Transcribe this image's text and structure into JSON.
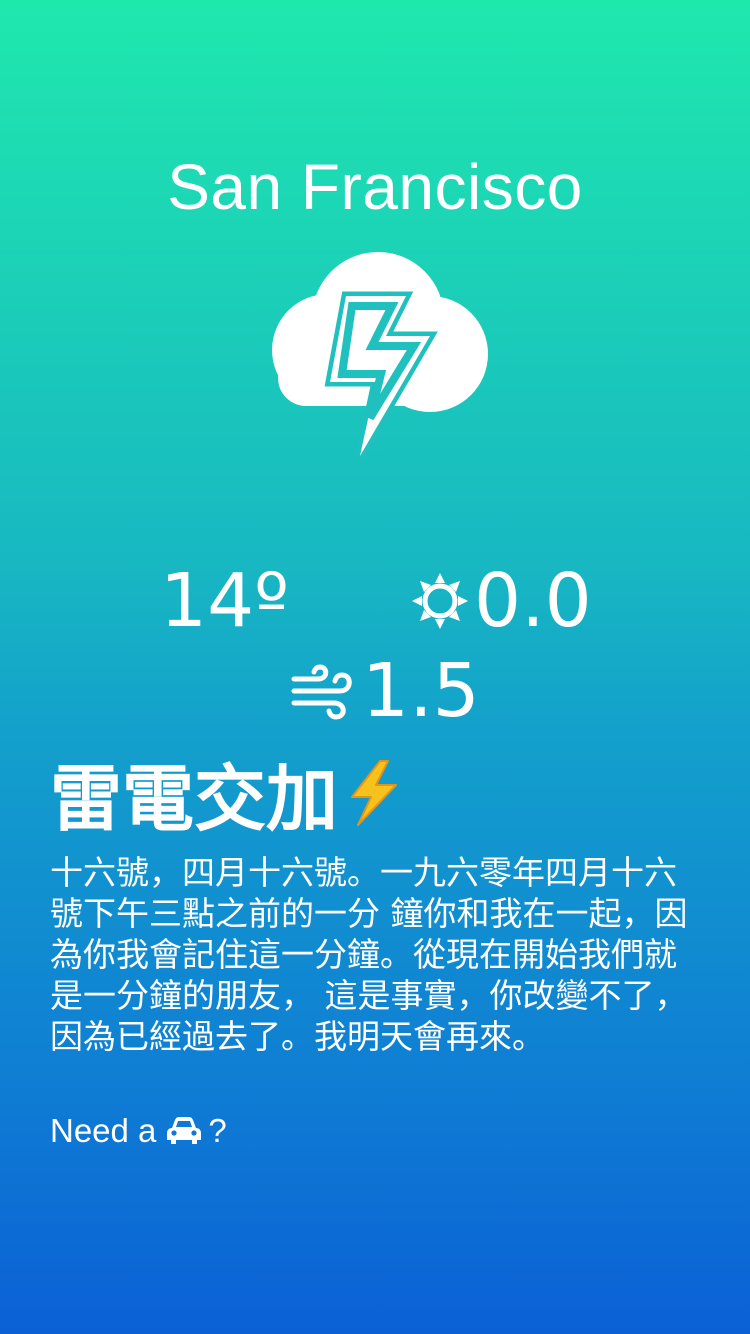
{
  "location": {
    "city": "San Francisco"
  },
  "current": {
    "icon": "thunderstorm-cloud-icon",
    "temperature": "14º",
    "uv_icon": "sun-icon",
    "uv_index": "0.0",
    "wind_icon": "wind-icon",
    "wind_speed": "1.5"
  },
  "condition": {
    "label": "雷電交加",
    "emoji": "high-voltage-icon"
  },
  "description": "十六號，四月十六號。一九六零年四月十六號下午三點之前的一分 鐘你和我在一起，因為你我會記住這一分鐘。從現在開始我們就是一分鐘的朋友， 這是事實，你改變不了，因為已經過去了。我明天會再來。",
  "ride": {
    "prefix": "Need a",
    "icon": "car-icon",
    "suffix": "?"
  },
  "colors": {
    "gradient_top": "#1fe8ad",
    "gradient_bottom": "#0b60d6",
    "text": "#ffffff",
    "bolt_outline": "#1fc0bd",
    "emoji_bolt": "#f7c21b"
  }
}
